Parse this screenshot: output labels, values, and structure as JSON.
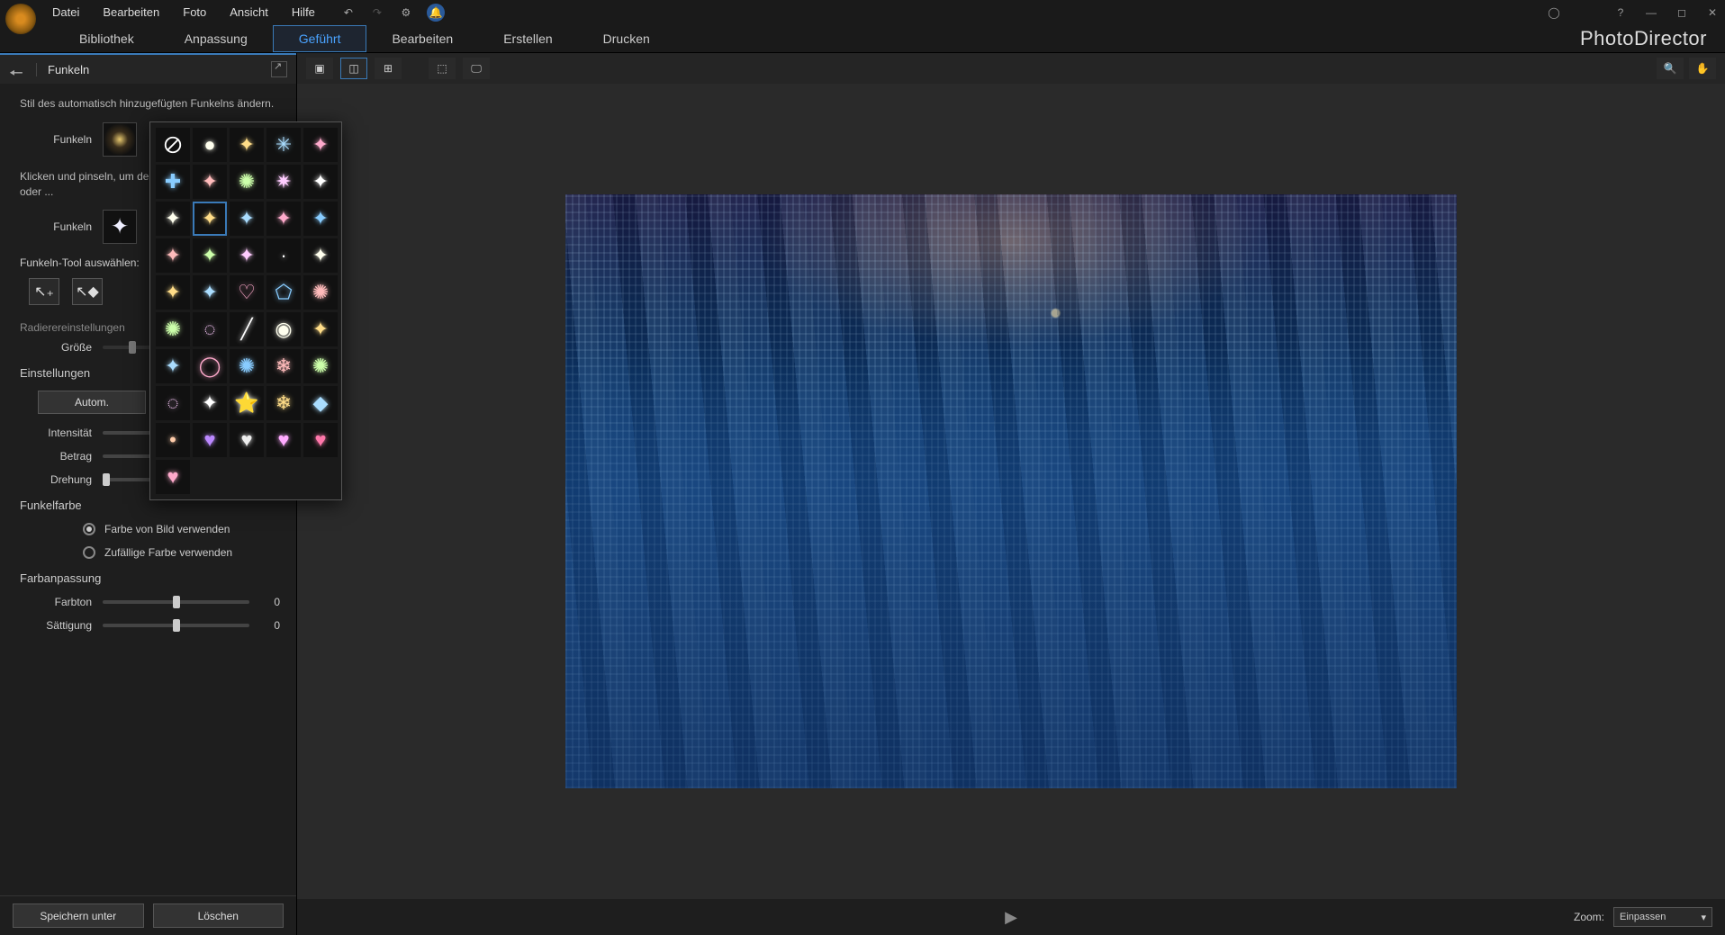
{
  "menu": {
    "file": "Datei",
    "edit": "Bearbeiten",
    "photo": "Foto",
    "view": "Ansicht",
    "help": "Hilfe"
  },
  "tabs": {
    "library": "Bibliothek",
    "adjust": "Anpassung",
    "guided": "Geführt",
    "edit": "Bearbeiten",
    "create": "Erstellen",
    "print": "Drucken"
  },
  "brand": "PhotoDirector",
  "panel": {
    "title": "Funkeln",
    "desc1": "Stil des automatisch hinzugefügten Funkelns ändern.",
    "label_sparkle": "Funkeln",
    "desc2": "Klicken und pinseln, um den Funkeln hinzuzufügen oder ...",
    "tool_select": "Funkeln-Tool auswählen:",
    "eraser_settings": "Radierereinstellungen",
    "size": "Größe",
    "settings": "Einstellungen",
    "auto": "Autom.",
    "intensity": "Intensität",
    "amount": "Betrag",
    "rotation": "Drehung",
    "rotation_val": "0",
    "sparkle_color": "Funkelfarbe",
    "radio1": "Farbe von Bild verwenden",
    "radio2": "Zufällige Farbe verwenden",
    "color_adjust": "Farbanpassung",
    "hue": "Farbton",
    "hue_val": "0",
    "saturation": "Sättigung",
    "sat_val": "0"
  },
  "footer": {
    "save": "Speichern unter",
    "delete": "Löschen"
  },
  "zoom": {
    "label": "Zoom:",
    "value": "Einpassen"
  },
  "popup_icons": [
    "none",
    "●",
    "✦",
    "✳",
    "✦",
    "✚",
    "✦",
    "✺",
    "✷",
    "✦",
    "✦",
    "✦",
    "✦",
    "✦",
    "✦",
    "✦",
    "✦",
    "✦",
    "·",
    "✦",
    "✦",
    "✦",
    "♡",
    "⬠",
    "✺",
    "✺",
    "◌",
    "╱",
    "◉",
    "✦",
    "✦",
    "◯",
    "✺",
    "❄",
    "✺",
    "◌",
    "✦",
    "⭐",
    "❄",
    "◆",
    "•",
    "♥",
    "♥",
    "♥",
    "♥",
    "♥"
  ]
}
